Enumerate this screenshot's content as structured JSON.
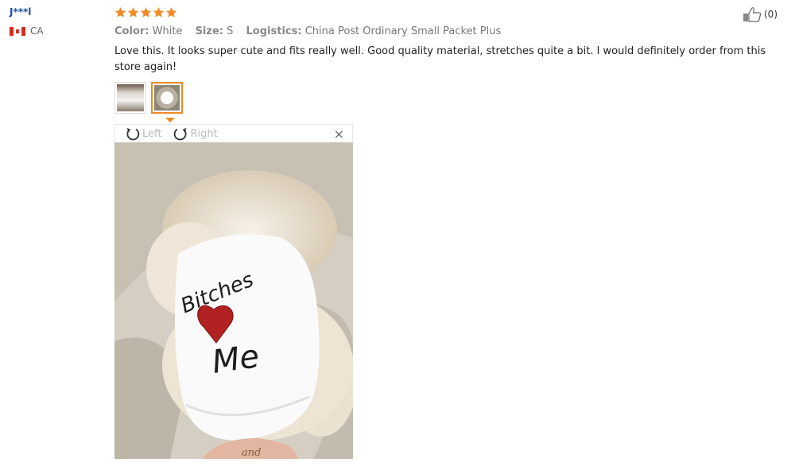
{
  "reviewer": {
    "name": "J***l",
    "country": "CA"
  },
  "review": {
    "rating": 5,
    "meta": [
      {
        "key": "Color:",
        "value": "White"
      },
      {
        "key": "Size:",
        "value": "S"
      },
      {
        "key": "Logistics:",
        "value": "China Post Ordinary Small Packet Plus"
      }
    ],
    "text": "Love this. It looks super cute and fits really well. Good quality material, stretches quite a bit. I would definitely order from this store again!",
    "helpful_count": "(0)"
  },
  "viewer": {
    "rotate_left": "Left",
    "rotate_right": "Right",
    "close": "×",
    "shirt_text_1": "Bitches",
    "shirt_text_2": "Me",
    "tag_text": "and"
  },
  "colors": {
    "star": "#f08a24",
    "accent": "#f08a24",
    "name": "#1a4fa0"
  },
  "icons": {
    "helpful": "thumbs-up-icon",
    "close": "close-icon"
  }
}
